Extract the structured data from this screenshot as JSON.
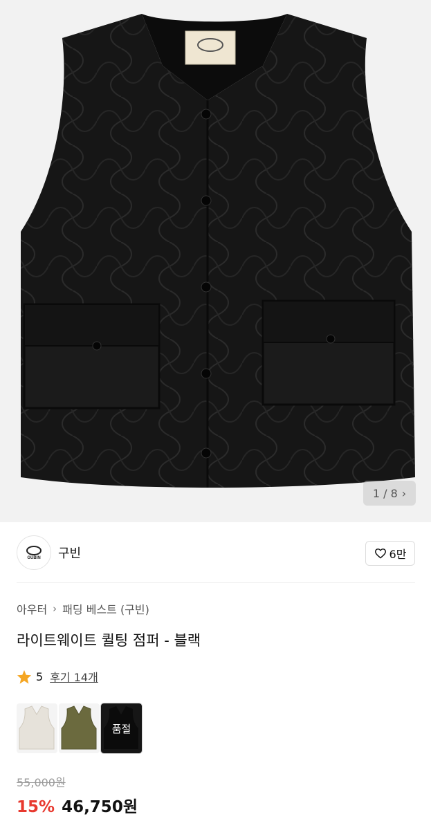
{
  "gallery": {
    "counter": "1 / 8",
    "next_icon": "chevron-right-icon"
  },
  "brand": {
    "name": "구빈",
    "logo_text": "GUBIN",
    "likes": "6만"
  },
  "breadcrumb": {
    "category": "아우터",
    "subcategory": "패딩 베스트 (구빈)"
  },
  "product": {
    "title": "라이트웨이트 퀼팅 점퍼 - 블랙",
    "rating": "5",
    "reviews": "후기 14개",
    "swatches": [
      {
        "color": "#e6e2da"
      },
      {
        "color": "#6b6a3e"
      },
      {
        "color": "#111111",
        "badge": "품절"
      }
    ]
  },
  "price": {
    "original": "55,000원",
    "discount": "15%",
    "final": "46,750원"
  },
  "colors": {
    "accent_red": "#e8392f",
    "star": "#f5a623"
  }
}
